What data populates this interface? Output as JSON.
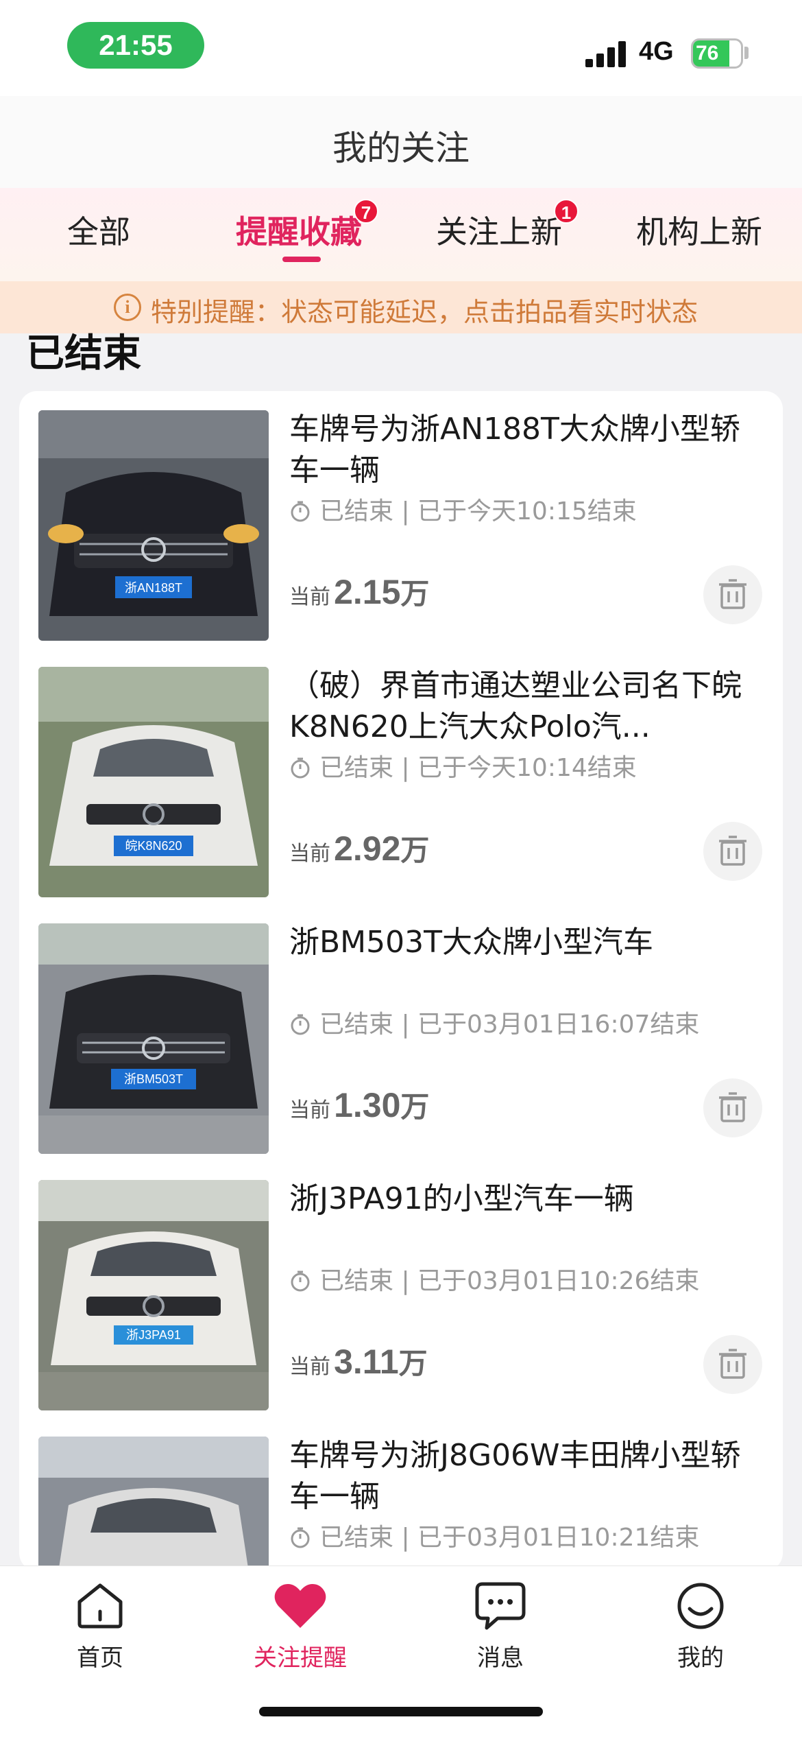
{
  "status_bar": {
    "time": "21:55",
    "network": "4G",
    "battery": "76"
  },
  "header": {
    "title": "我的关注"
  },
  "tabs": [
    {
      "label": "全部",
      "badge": ""
    },
    {
      "label": "提醒收藏",
      "badge": "7",
      "active": true
    },
    {
      "label": "关注上新",
      "badge": "1"
    },
    {
      "label": "机构上新",
      "badge": ""
    }
  ],
  "notice": {
    "icon": "info-icon",
    "text": "特别提醒：状态可能延迟，点击拍品看实时状态"
  },
  "section": {
    "title": "已结束"
  },
  "items": [
    {
      "title": "车牌号为浙AN188T大众牌小型轿车一辆",
      "status": "已结束 | 已于今天10:15结束",
      "price_label": "当前",
      "price": "2.15",
      "unit": "万",
      "plate": "浙AN188T",
      "car_color": "#1f2027",
      "bg": "#6a6e74"
    },
    {
      "title": "（破）界首市通达塑业公司名下皖K8N620上汽大众Polo汽...",
      "status": "已结束 | 已于今天10:14结束",
      "price_label": "当前",
      "price": "2.92",
      "unit": "万",
      "plate": "皖K8N620",
      "car_color": "#e9e9e6",
      "bg": "#7c8a6e"
    },
    {
      "title": "浙BM503T大众牌小型汽车",
      "status": "已结束 | 已于03月01日16:07结束",
      "price_label": "当前",
      "price": "1.30",
      "unit": "万",
      "plate": "浙BM503T",
      "car_color": "#25262b",
      "bg": "#8c9096"
    },
    {
      "title": "浙J3PA91的小型汽车一辆",
      "status": "已结束 | 已于03月01日10:26结束",
      "price_label": "当前",
      "price": "3.11",
      "unit": "万",
      "plate": "浙J3PA91",
      "car_color": "#ecebe7",
      "bg": "#7e8378"
    },
    {
      "title": "车牌号为浙J8G06W丰田牌小型轿车一辆",
      "status": "已结束 | 已于03月01日10:21结束",
      "price_label": "",
      "price": "",
      "unit": "",
      "plate": "",
      "car_color": "#dcdcdc",
      "bg": "#8a8f97"
    }
  ],
  "bottom_nav": [
    {
      "label": "首页",
      "icon": "home-icon"
    },
    {
      "label": "关注提醒",
      "icon": "heart-icon",
      "active": true
    },
    {
      "label": "消息",
      "icon": "message-icon"
    },
    {
      "label": "我的",
      "icon": "smile-icon"
    }
  ],
  "colors": {
    "accent": "#e0245e",
    "badge": "#e8173a",
    "notice_text": "#cf7a39",
    "notice_bg": "#fde6d6"
  }
}
